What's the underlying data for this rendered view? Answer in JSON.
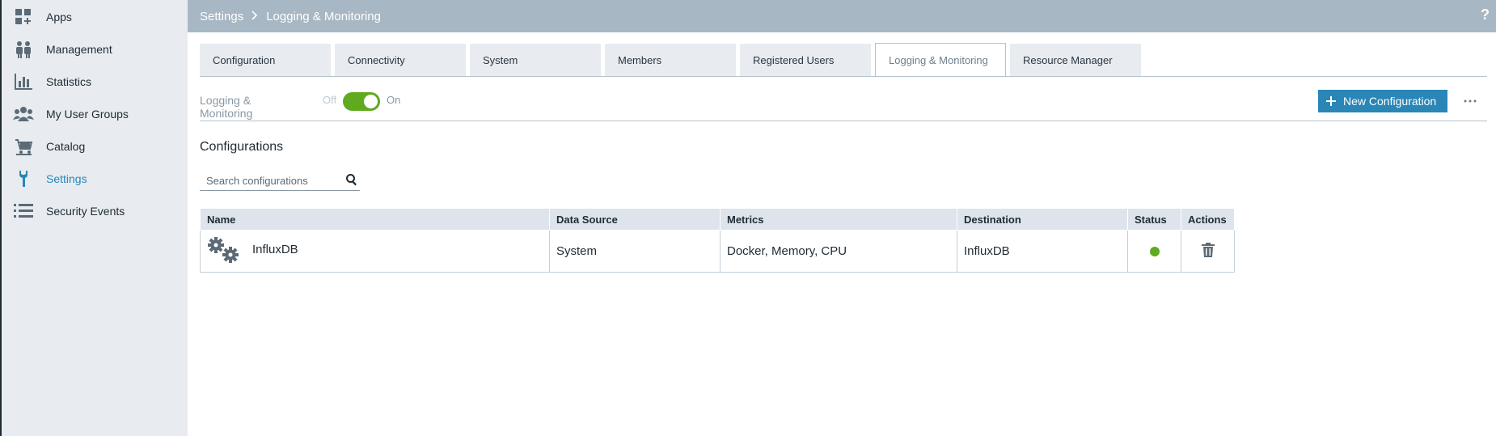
{
  "sidebar": {
    "items": [
      {
        "label": "Apps",
        "icon": "apps-icon"
      },
      {
        "label": "Management",
        "icon": "management-icon"
      },
      {
        "label": "Statistics",
        "icon": "statistics-icon"
      },
      {
        "label": "My User Groups",
        "icon": "user-groups-icon"
      },
      {
        "label": "Catalog",
        "icon": "catalog-icon"
      },
      {
        "label": "Settings",
        "icon": "wrench-icon",
        "active": true
      },
      {
        "label": "Security Events",
        "icon": "list-icon"
      }
    ]
  },
  "header": {
    "breadcrumb_root": "Settings",
    "breadcrumb_current": "Logging & Monitoring",
    "help": "?"
  },
  "tabs": [
    {
      "label": "Configuration"
    },
    {
      "label": "Connectivity"
    },
    {
      "label": "System"
    },
    {
      "label": "Members"
    },
    {
      "label": "Registered Users"
    },
    {
      "label": "Logging & Monitoring",
      "active": true
    },
    {
      "label": "Resource Manager"
    }
  ],
  "toggle": {
    "label": "Logging & Monitoring",
    "off": "Off",
    "on": "On",
    "state": "on"
  },
  "actions": {
    "new_config": "New Configuration"
  },
  "section": {
    "title": "Configurations"
  },
  "search": {
    "placeholder": "Search configurations",
    "value": ""
  },
  "table": {
    "headers": [
      "Name",
      "Data Source",
      "Metrics",
      "Destination",
      "Status",
      "Actions"
    ],
    "rows": [
      {
        "name": "InfluxDB",
        "data_source": "System",
        "metrics": "Docker, Memory, CPU",
        "destination": "InfluxDB",
        "status": "active"
      }
    ]
  },
  "colors": {
    "accent": "#2a86b6",
    "toggle_on": "#5faa1e",
    "status_ok": "#5faa1e",
    "header_bar": "#a7b7c4"
  }
}
